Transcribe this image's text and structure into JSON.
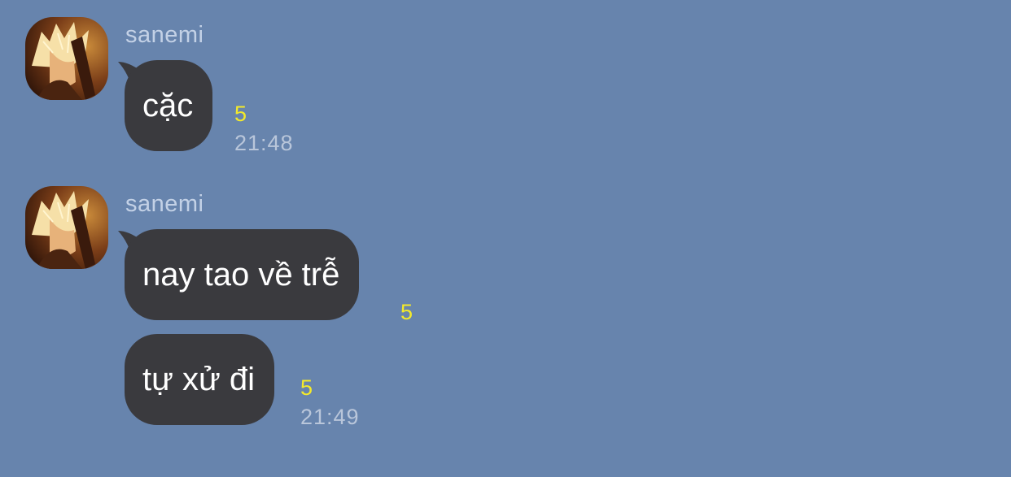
{
  "conversation": {
    "groups": [
      {
        "sender": "sanemi",
        "messages": [
          {
            "text": "cặc",
            "read_count": "5",
            "time": "21:48"
          }
        ]
      },
      {
        "sender": "sanemi",
        "messages": [
          {
            "text": "nay tao về trễ",
            "read_count": "5",
            "time": ""
          },
          {
            "text": "tự xử đi",
            "read_count": "5",
            "time": "21:49"
          }
        ]
      }
    ]
  },
  "icons": {
    "avatar": "user-avatar-image"
  },
  "colors": {
    "background": "#6784ad",
    "bubble": "#3a3a3e",
    "bubble_text": "#ffffff",
    "sender_name": "#c3d1e6",
    "read_count": "#f4ea2a",
    "timestamp": "#b9c6da"
  }
}
